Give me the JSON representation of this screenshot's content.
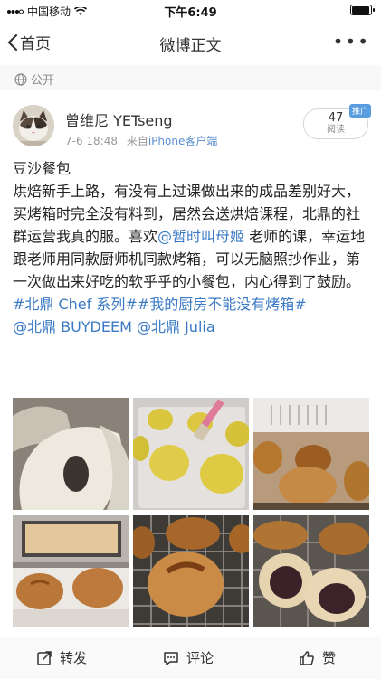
{
  "status_bar": {
    "carrier": "中国移动",
    "wifi_icon": "wifi-icon",
    "time": "下午6:49",
    "battery_icon": "battery-icon"
  },
  "nav": {
    "back_label": "首页",
    "title": "微博正文",
    "more_icon": "more-icon"
  },
  "visibility": {
    "label": "公开",
    "icon": "public-icon"
  },
  "author": {
    "name": "曾维尼 YETseng",
    "date": "7-6 18:48",
    "source_prefix": "来自",
    "source": "iPhone客户端",
    "reads_count": "47",
    "reads_label": "阅读",
    "promo_badge": "推广"
  },
  "post": {
    "title": "豆沙餐包",
    "body_1": "烘焙新手上路，有没有上过课做出来的成品差别好大，买烤箱时完全没有料到，居然会送烘焙课程，北鼎的社群运营我真的服。喜欢",
    "mention_teacher": "@暂时叫母姬",
    "body_2": " 老师的课，幸运地跟老师用同款厨师机同款烤箱，可以无脑照抄作业，第一次做出来好吃的软乎乎的小餐包，内心得到了鼓励。",
    "hashtag_1": "#北鼎 Chef 系列#",
    "hashtag_2": "#我的厨房不能没有烤箱#",
    "mention_brand": "@北鼎 BUYDEEM",
    "mention_julia": "@北鼎 Julia"
  },
  "photos": [
    {
      "label": "dough-stretch-photo"
    },
    {
      "label": "egg-wash-brushing-photo"
    },
    {
      "label": "oven-baking-photo"
    },
    {
      "label": "oven-front-photo"
    },
    {
      "label": "bun-on-rack-photo"
    },
    {
      "label": "bun-cross-section-photo"
    }
  ],
  "actions": {
    "repost": "转发",
    "comment": "评论",
    "like": "赞"
  },
  "colors": {
    "link": "#3a79c4",
    "muted": "#999999",
    "badge": "#5a9ce0"
  }
}
